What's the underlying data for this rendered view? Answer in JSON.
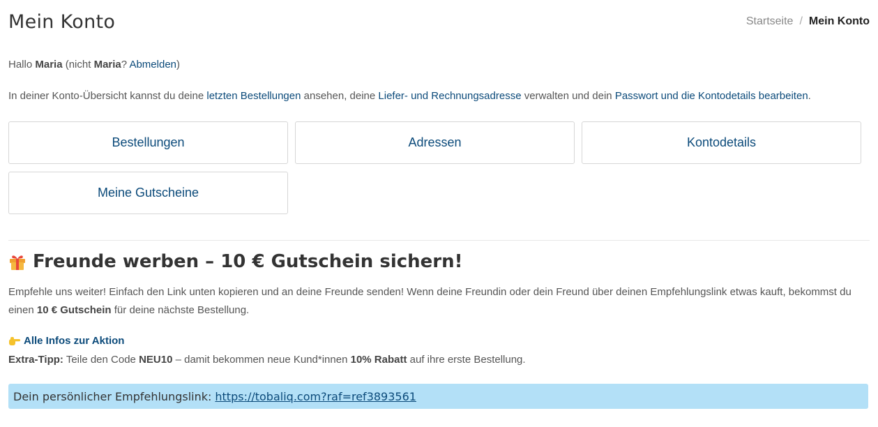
{
  "page": {
    "title": "Mein Konto"
  },
  "breadcrumb": {
    "home": "Startseite",
    "separator": "/",
    "current": "Mein Konto"
  },
  "greeting": {
    "hello": "Hallo",
    "name": "Maria",
    "not_prefix": "(nicht",
    "not_name": "Maria",
    "question": "?",
    "logout": "Abmelden",
    "close_paren": ")"
  },
  "overview": {
    "part1": "In deiner Konto-Übersicht kannst du deine",
    "link_orders": "letzten Bestellungen",
    "part2": "ansehen, deine",
    "link_addresses": "Liefer- und Rechnungsadresse",
    "part3": "verwalten und dein",
    "link_account": "Passwort und die Kontodetails bearbeiten",
    "part4": "."
  },
  "tiles": {
    "orders": "Bestellungen",
    "addresses": "Adressen",
    "account_details": "Kontodetails",
    "vouchers": "Meine Gutscheine"
  },
  "referral": {
    "title": "Freunde werben – 10 € Gutschein sichern!",
    "text_part1": "Empfehle uns weiter! Einfach den Link unten kopieren und an deine Freunde senden! Wenn deine Freundin oder dein Freund über deinen Empfehlungslink etwas kauft, bekommst du einen",
    "text_bold": "10 € Gutschein",
    "text_part2": "für deine nächste Bestellung.",
    "info_link": "Alle Infos zur Aktion",
    "tip_label": "Extra-Tipp:",
    "tip_part1": "Teile den Code",
    "tip_code": "NEU10",
    "tip_part2": "– damit bekommen neue Kund*innen",
    "tip_discount": "10% Rabatt",
    "tip_part3": "auf ihre erste Bestellung.",
    "link_label": "Dein persönlicher Empfehlungslink:",
    "link_url": "https://tobaliq.com?raf=ref3893561"
  },
  "colors": {
    "link": "#0b4a7a",
    "ref_box_bg": "#b3e0f7"
  },
  "icons": {
    "gift": "gift-icon",
    "pointing_hand": "pointing-hand-icon"
  }
}
